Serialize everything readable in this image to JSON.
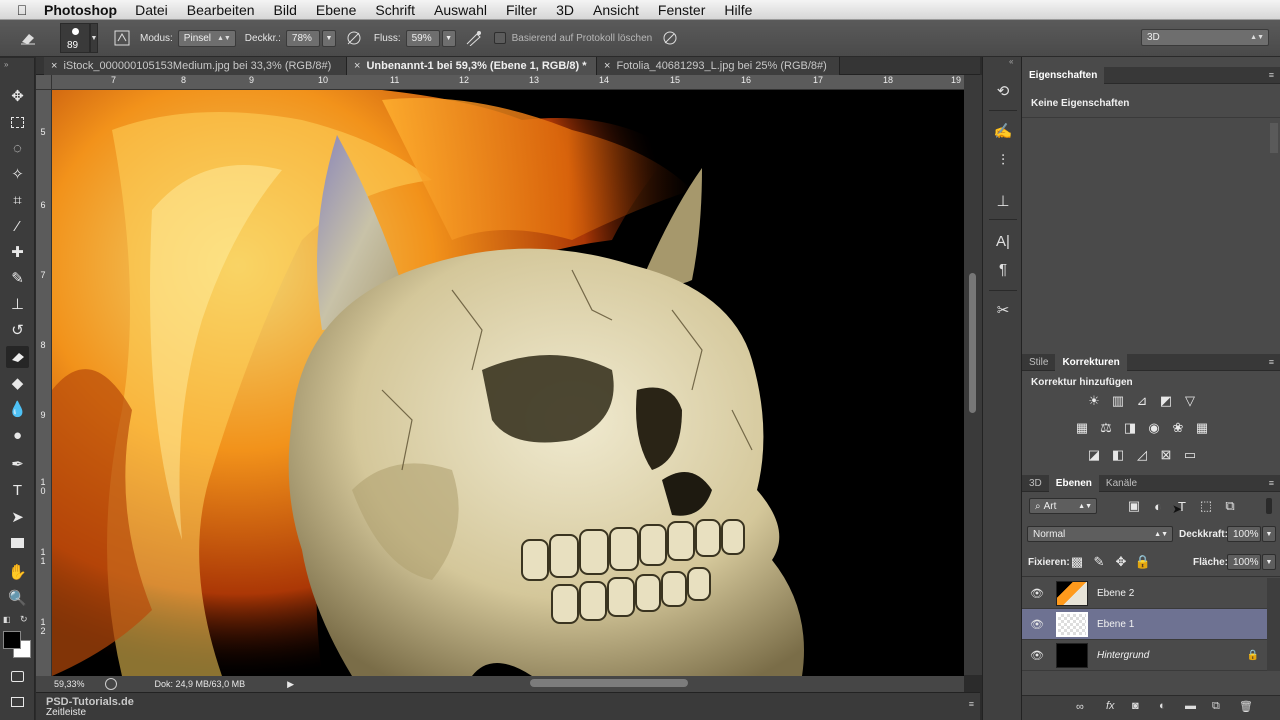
{
  "menubar": {
    "app_name": "Photoshop",
    "items": [
      "Datei",
      "Bearbeiten",
      "Bild",
      "Ebene",
      "Schrift",
      "Auswahl",
      "Filter",
      "3D",
      "Ansicht",
      "Fenster",
      "Hilfe"
    ]
  },
  "options": {
    "brush_size": "89",
    "mode_label": "Modus:",
    "mode_value": "Pinsel",
    "opacity_label": "Deckkr.:",
    "opacity_value": "78%",
    "flow_label": "Fluss:",
    "flow_value": "59%",
    "history_label": "Basierend auf Protokoll löschen",
    "workspace": "3D"
  },
  "tabs": [
    {
      "label": "iStock_000000105153Medium.jpg bei 33,3% (RGB/8#)"
    },
    {
      "label": "Unbenannt-1 bei 59,3% (Ebene 1, RGB/8) *"
    },
    {
      "label": "Fotolia_40681293_L.jpg bei 25% (RGB/8#)"
    }
  ],
  "ruler": {
    "top": [
      "7",
      "8",
      "9",
      "10",
      "11",
      "12",
      "13",
      "14",
      "15",
      "16",
      "17",
      "18",
      "19"
    ],
    "left": [
      "5",
      "6",
      "7",
      "8",
      "9",
      "10",
      "11",
      "12"
    ]
  },
  "status": {
    "zoom": "59,33%",
    "doc": "Dok: 24,9 MB/63,0 MB",
    "watermark": "PSD-Tutorials.de",
    "timeline": "Zeitleiste"
  },
  "properties": {
    "tab": "Eigenschaften",
    "empty": "Keine Eigenschaften"
  },
  "adjustments": {
    "tabs": [
      "Stile",
      "Korrekturen"
    ],
    "title": "Korrektur hinzufügen"
  },
  "layers_panel": {
    "tabs": [
      "3D",
      "Ebenen",
      "Kanäle"
    ],
    "filter": "Art",
    "blend_mode": "Normal",
    "opacity_label": "Deckkraft:",
    "opacity_value": "100%",
    "lock_label": "Fixieren:",
    "fill_label": "Fläche:",
    "fill_value": "100%",
    "layers": [
      {
        "name": "Ebene 2"
      },
      {
        "name": "Ebene 1"
      },
      {
        "name": "Hintergrund"
      }
    ]
  },
  "colors": {
    "accent_selected_layer": "#6e7292",
    "panel_bg": "#4a4a4a"
  }
}
